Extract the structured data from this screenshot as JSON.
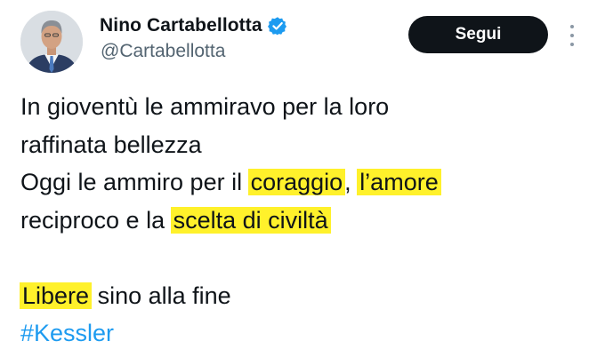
{
  "author": {
    "display_name": "Nino Cartabellotta",
    "handle": "@Cartabellotta",
    "verified": true
  },
  "follow_button": {
    "label": "Segui"
  },
  "tweet": {
    "line1": "In gioventù le ammiravo per la loro",
    "line2": "raffinata bellezza",
    "line3": {
      "before": "Oggi le ammiro per il ",
      "highlight1": "coraggio",
      "between": ", ",
      "highlight2": "l’amore"
    },
    "line4": {
      "before": "reciproco e la ",
      "highlight": "scelta di civiltà"
    },
    "line5": {
      "highlight": "Libere",
      "after": " sino alla fine"
    },
    "hashtag": "#Kessler"
  },
  "colors": {
    "highlight": "#fff12b",
    "hashtag": "#1d9bf0",
    "verified_badge": "#1d9bf0",
    "follow_button_bg": "#0f1419",
    "handle_text": "#536471"
  },
  "icons": {
    "verified": "verified-badge-icon",
    "more": "more-options-icon"
  }
}
